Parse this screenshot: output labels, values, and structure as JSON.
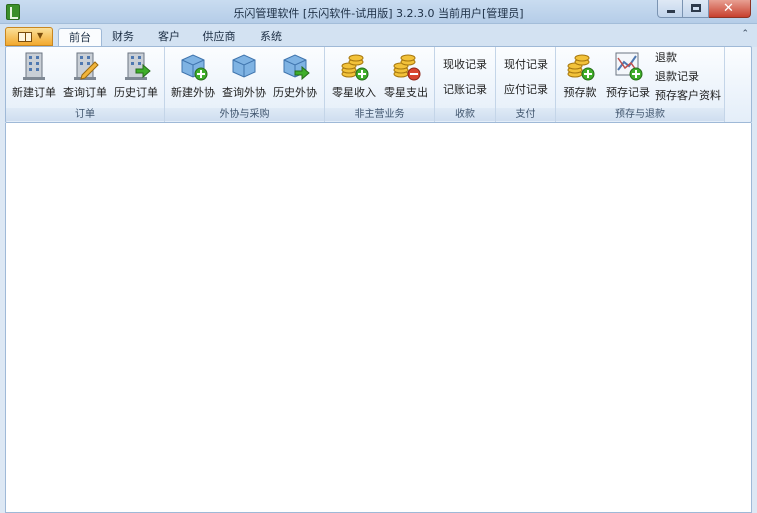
{
  "window": {
    "title": "乐闪管理软件 [乐闪软件-试用版] 3.2.3.0   当前用户[管理员]",
    "controls": {
      "minimize": "",
      "maximize": "",
      "close": "✕"
    }
  },
  "tabs": [
    {
      "label": "前台",
      "active": true
    },
    {
      "label": "财务",
      "active": false
    },
    {
      "label": "客户",
      "active": false
    },
    {
      "label": "供应商",
      "active": false
    },
    {
      "label": "系统",
      "active": false
    }
  ],
  "collapse_glyph": "⌃",
  "ribbon": {
    "orders": {
      "label": "订单",
      "buttons": [
        "新建订单",
        "查询订单",
        "历史订单"
      ]
    },
    "outsourcing": {
      "label": "外协与采购",
      "buttons": [
        "新建外协",
        "查询外协",
        "历史外协"
      ]
    },
    "non_core": {
      "label": "非主营业务",
      "buttons": [
        "零星收入",
        "零星支出"
      ]
    },
    "receipts": {
      "label": "收款",
      "buttons": [
        "现收记录",
        "记账记录"
      ]
    },
    "payments": {
      "label": "支付",
      "buttons": [
        "现付记录",
        "应付记录"
      ]
    },
    "deposits": {
      "label": "预存与退款",
      "buttons": [
        "预存款",
        "预存记录"
      ],
      "small_buttons": [
        "退款",
        "退款记录",
        "预存客户资料"
      ]
    }
  },
  "icons": {
    "orders": [
      "building-icon",
      "building-pencil-icon",
      "building-arrow-icon"
    ],
    "outsourcing": [
      "cube-add-icon",
      "cube-icon",
      "cube-arrow-icon"
    ],
    "non_core": [
      "coins-add-icon",
      "coins-remove-icon"
    ],
    "deposits": [
      "coins-add-icon",
      "chart-add-icon"
    ]
  },
  "colors": {
    "accent_orange": "#f2a92e",
    "green_badge": "#3fae2a",
    "red_badge": "#d8452f"
  }
}
